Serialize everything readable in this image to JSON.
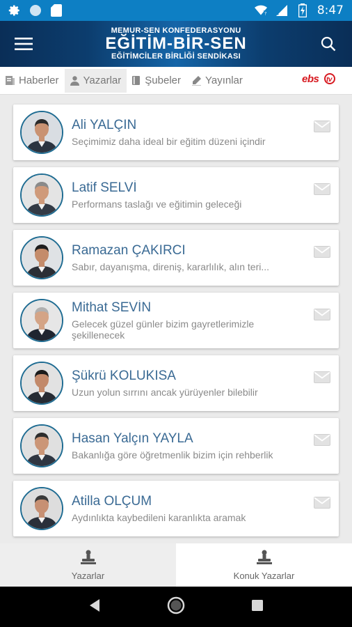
{
  "status_bar": {
    "time": "8:47"
  },
  "app_bar": {
    "logo_line1": "MEMUR-SEN KONFEDERASYONU",
    "logo_line2": "EĞİTİM-BİR-SEN",
    "logo_line3": "EĞİTİMCİLER BİRLİĞİ SENDİKASI"
  },
  "tabs": [
    {
      "label": "Haberler",
      "icon": "document-icon",
      "active": false
    },
    {
      "label": "Yazarlar",
      "icon": "user-icon",
      "active": true
    },
    {
      "label": "Şubeler",
      "icon": "book-icon",
      "active": false
    },
    {
      "label": "Yayınlar",
      "icon": "pen-icon",
      "active": false
    }
  ],
  "brand_tab": "ebsTV",
  "authors": [
    {
      "name": "Ali YALÇIN",
      "title": "Seçimimiz daha ideal bir eğitim düzeni içindir"
    },
    {
      "name": "Latif SELVİ",
      "title": "Performans taslağı ve eğitimin geleceği"
    },
    {
      "name": "Ramazan ÇAKIRCI",
      "title": "Sabır, dayanışma, direniş, kararlılık, alın teri..."
    },
    {
      "name": "Mithat SEVİN",
      "title": "Gelecek güzel günler bizim gayretlerimizle şekillenecek"
    },
    {
      "name": "Şükrü KOLUKISA",
      "title": "Uzun yolun sırrını ancak yürüyenler bilebilir"
    },
    {
      "name": "Hasan Yalçın YAYLA",
      "title": "Bakanlığa göre öğretmenlik bizim için rehberlik"
    },
    {
      "name": "Atilla OLÇUM",
      "title": "Aydınlıkta kaybedileni karanlıkta aramak"
    }
  ],
  "bottom_nav": [
    {
      "label": "Yazarlar",
      "icon": "stamp-icon",
      "active": true
    },
    {
      "label": "Konuk Yazarlar",
      "icon": "stamp-icon",
      "active": false
    }
  ],
  "colors": {
    "status_bar": "#0d7fc4",
    "app_bar": "#0c3d6e",
    "author_name": "#3a6a94",
    "brand": "#d71920"
  }
}
